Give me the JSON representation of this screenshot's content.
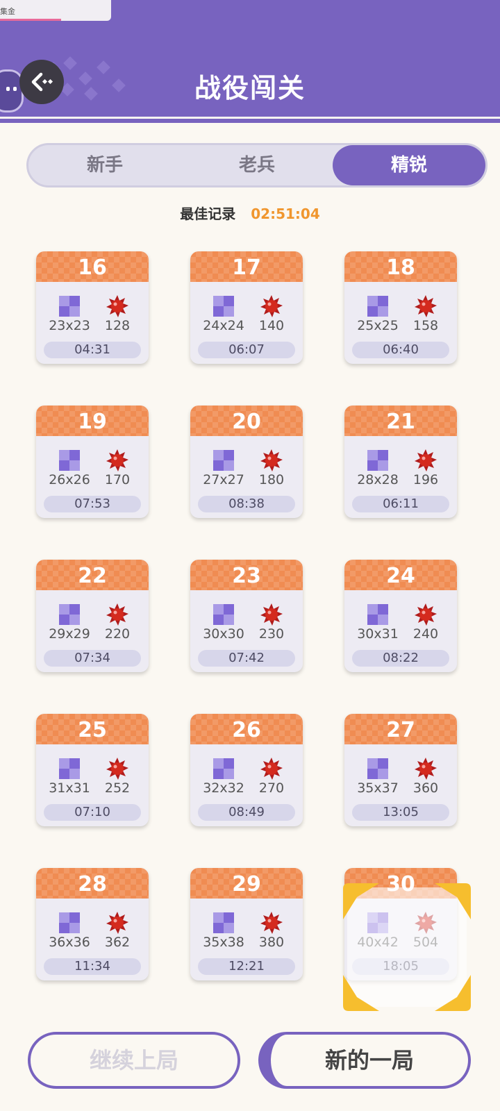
{
  "ad": {
    "text": "集金"
  },
  "header": {
    "title": "战役闯关"
  },
  "tabs": [
    {
      "label": "新手",
      "active": false
    },
    {
      "label": "老兵",
      "active": false
    },
    {
      "label": "精锐",
      "active": true
    }
  ],
  "best": {
    "label": "最佳记录",
    "value": "02:51:04"
  },
  "levels": [
    {
      "num": "16",
      "size": "23x23",
      "mines": "128",
      "time": "04:31"
    },
    {
      "num": "17",
      "size": "24x24",
      "mines": "140",
      "time": "06:07"
    },
    {
      "num": "18",
      "size": "25x25",
      "mines": "158",
      "time": "06:40"
    },
    {
      "num": "19",
      "size": "26x26",
      "mines": "170",
      "time": "07:53"
    },
    {
      "num": "20",
      "size": "27x27",
      "mines": "180",
      "time": "08:38"
    },
    {
      "num": "21",
      "size": "28x28",
      "mines": "196",
      "time": "06:11"
    },
    {
      "num": "22",
      "size": "29x29",
      "mines": "220",
      "time": "07:34"
    },
    {
      "num": "23",
      "size": "30x30",
      "mines": "230",
      "time": "07:42"
    },
    {
      "num": "24",
      "size": "30x31",
      "mines": "240",
      "time": "08:22"
    },
    {
      "num": "25",
      "size": "31x31",
      "mines": "252",
      "time": "07:10"
    },
    {
      "num": "26",
      "size": "32x32",
      "mines": "270",
      "time": "08:49"
    },
    {
      "num": "27",
      "size": "35x37",
      "mines": "360",
      "time": "13:05"
    },
    {
      "num": "28",
      "size": "36x36",
      "mines": "362",
      "time": "11:34"
    },
    {
      "num": "29",
      "size": "35x38",
      "mines": "380",
      "time": "12:21"
    },
    {
      "num": "30",
      "size": "40x42",
      "mines": "504",
      "time": "18:05",
      "selected": true
    }
  ],
  "buttons": {
    "continue": "继续上局",
    "new_game": "新的一局"
  },
  "colors": {
    "primary": "#7863bf",
    "accent": "#f08c52",
    "best_time": "#f0962e",
    "selection": "#f6be2e"
  }
}
